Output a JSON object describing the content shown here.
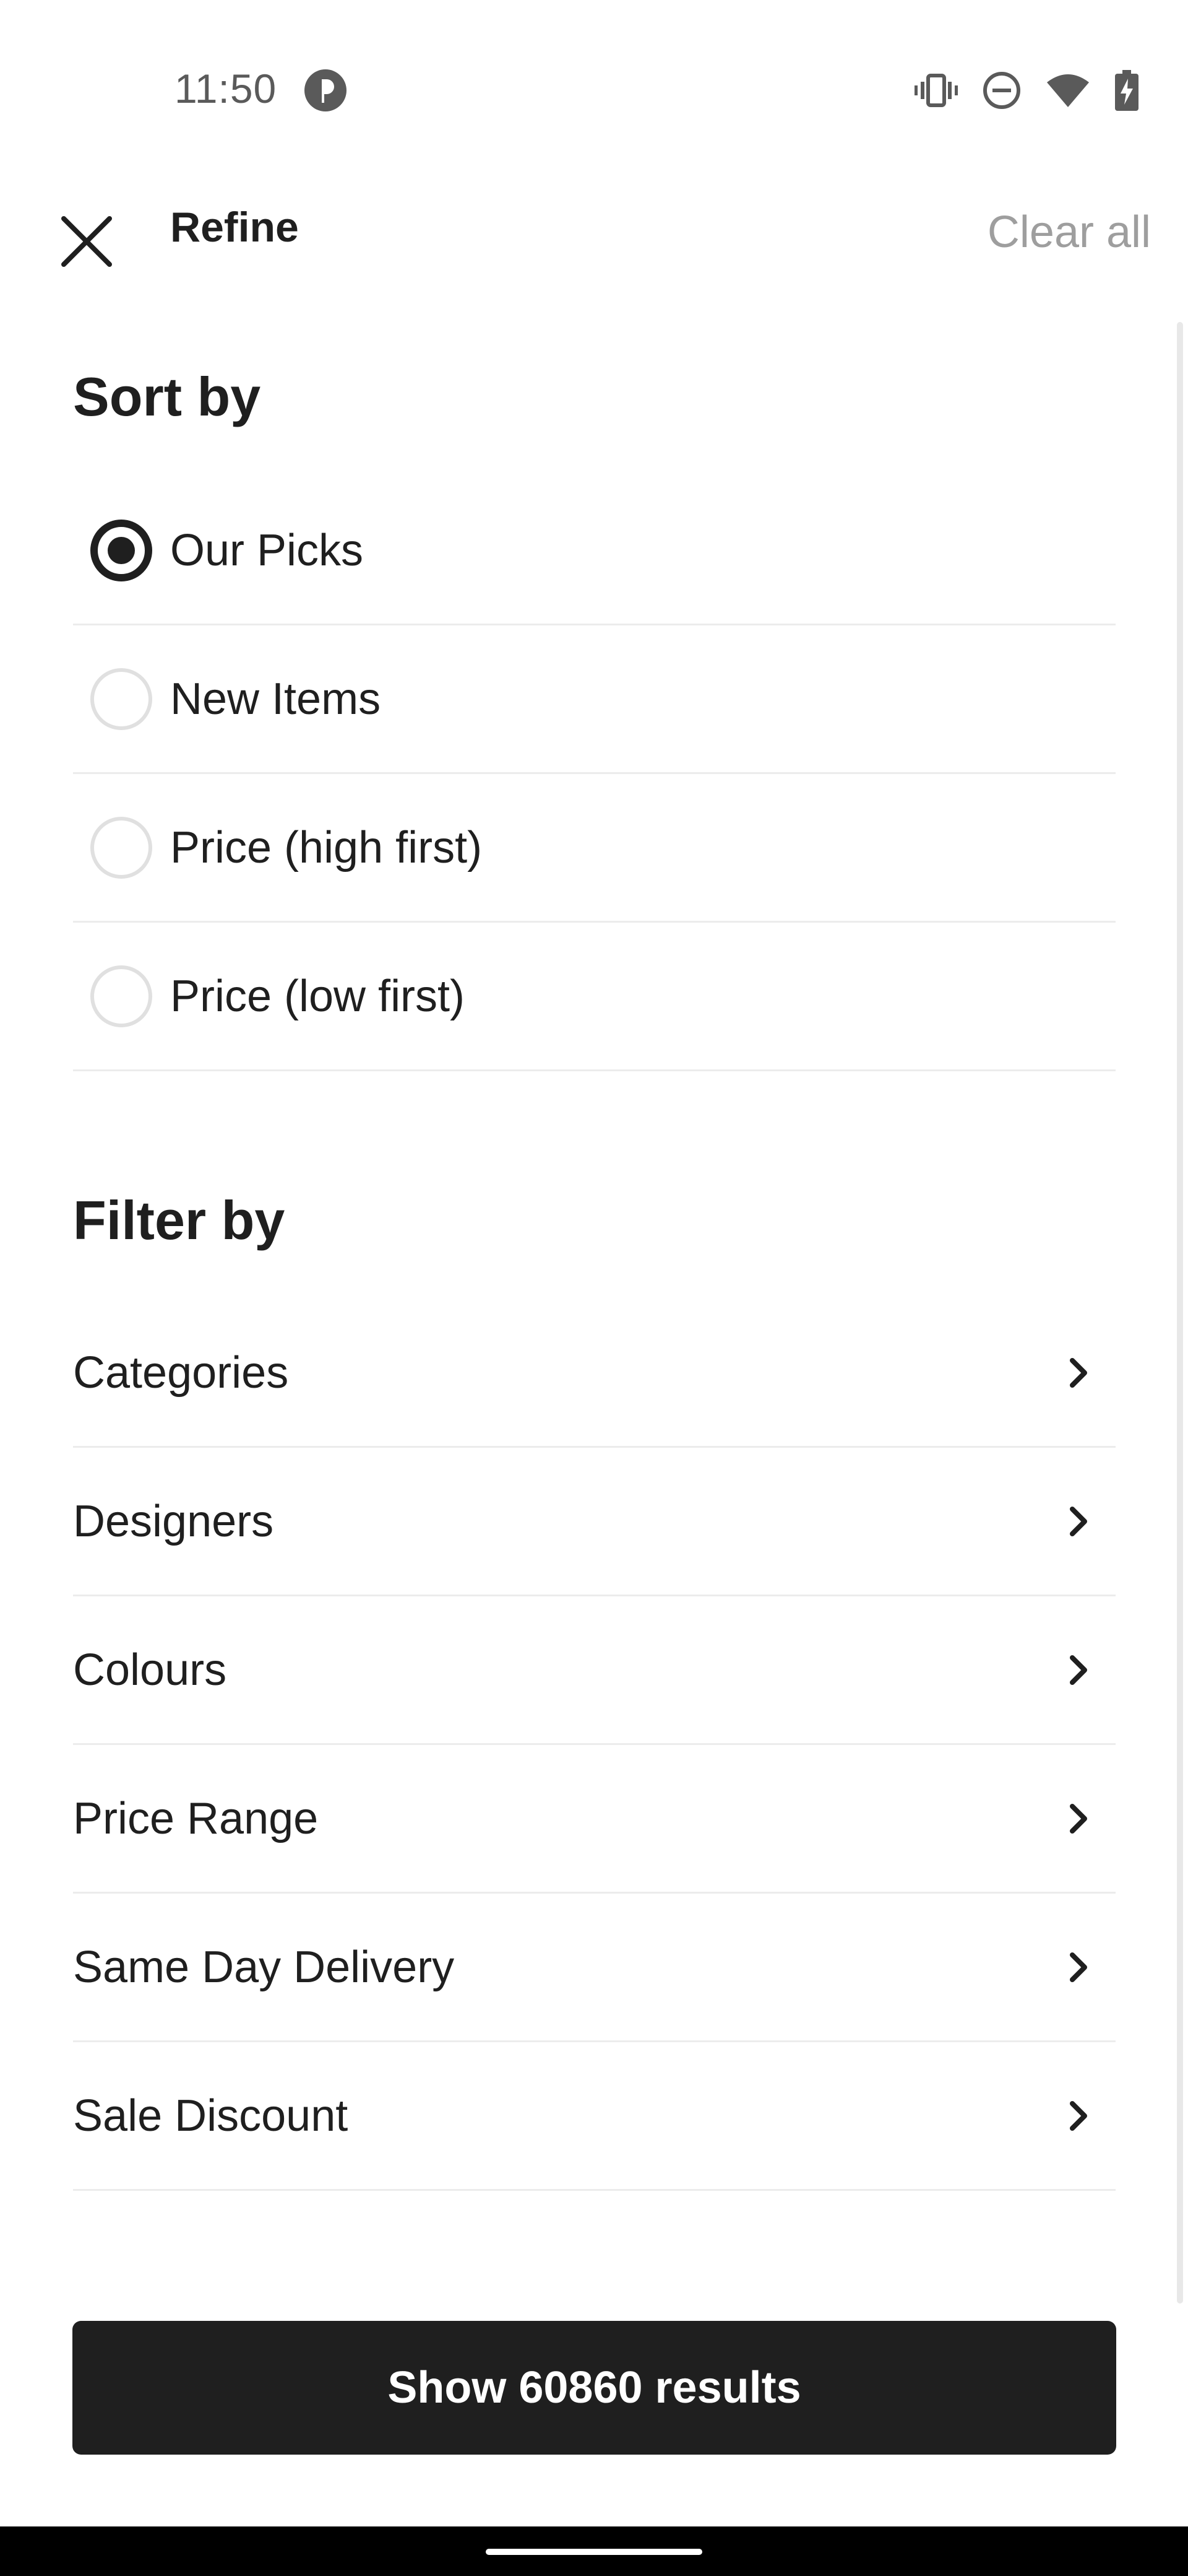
{
  "status_bar": {
    "time": "11:50",
    "icons": [
      "app-badge-icon",
      "vibrate-icon",
      "do-not-disturb-icon",
      "wifi-icon",
      "battery-charging-icon"
    ]
  },
  "header": {
    "title": "Refine",
    "clear_all": "Clear all",
    "close_icon": "close-icon"
  },
  "sort": {
    "title": "Sort by",
    "options": [
      {
        "label": "Our Picks",
        "selected": true
      },
      {
        "label": "New Items",
        "selected": false
      },
      {
        "label": "Price (high first)",
        "selected": false
      },
      {
        "label": "Price (low first)",
        "selected": false
      }
    ]
  },
  "filter": {
    "title": "Filter by",
    "items": [
      {
        "label": "Categories"
      },
      {
        "label": "Designers"
      },
      {
        "label": "Colours"
      },
      {
        "label": "Price Range"
      },
      {
        "label": "Same Day Delivery"
      },
      {
        "label": "Sale Discount"
      }
    ],
    "chevron_icon": "chevron-right-icon"
  },
  "primary_action": {
    "label": "Show 60860 results"
  },
  "colors": {
    "text": "#1f1f1f",
    "muted": "#9e9e9e",
    "divider": "#ececec",
    "button_bg": "#1f1f1f",
    "button_text": "#ffffff"
  }
}
